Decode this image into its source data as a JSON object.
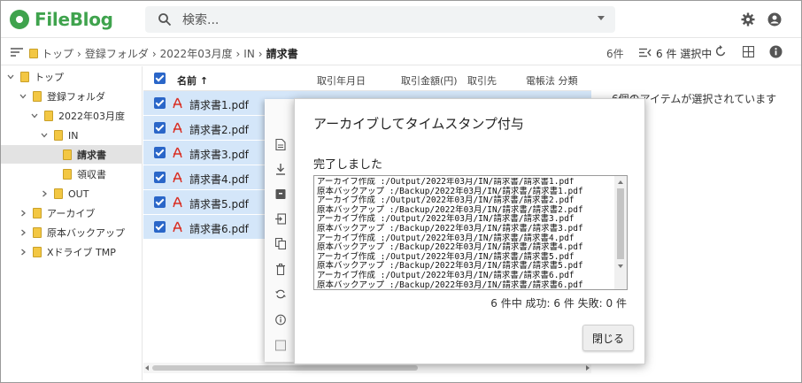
{
  "app": {
    "name": "FileBlog"
  },
  "search": {
    "placeholder": "検索..."
  },
  "breadcrumb": {
    "items": [
      "トップ",
      "登録フォルダ",
      "2022年03月度",
      "IN"
    ],
    "current": "請求書"
  },
  "toolbar": {
    "count": "6件",
    "selection": "6 件 選択中"
  },
  "tree": [
    {
      "label": "トップ",
      "level": 0,
      "expanded": true
    },
    {
      "label": "登録フォルダ",
      "level": 1,
      "expanded": true
    },
    {
      "label": "2022年03月度",
      "level": 2,
      "expanded": true
    },
    {
      "label": "IN",
      "level": 3,
      "expanded": true
    },
    {
      "label": "請求書",
      "level": 4,
      "selected": true
    },
    {
      "label": "領収書",
      "level": 4
    },
    {
      "label": "OUT",
      "level": 3,
      "expanded": false
    },
    {
      "label": "アーカイブ",
      "level": 0,
      "expanded": false
    },
    {
      "label": "原本バックアップ",
      "level": 0,
      "expanded": false
    },
    {
      "label": "Xドライブ TMP",
      "level": 0,
      "expanded": false
    }
  ],
  "list": {
    "headers": {
      "name": "名前 ↑",
      "date": "取引年月日",
      "amount": "取引金額(円)",
      "partner": "取引先",
      "category": "電帳法 分類"
    },
    "rows": [
      "請求書1.pdf",
      "請求書2.pdf",
      "請求書3.pdf",
      "請求書4.pdf",
      "請求書5.pdf",
      "請求書6.pdf"
    ]
  },
  "info_panel": {
    "text": "6個のアイテムが選択されています"
  },
  "dialog": {
    "title": "アーカイブしてタイムスタンプ付与",
    "status": "完了しました",
    "log": [
      "アーカイブ作成 :/Output/2022年03月/IN/請求書/請求書1.pdf",
      "原本バックアップ :/Backup/2022年03月/IN/請求書/請求書1.pdf",
      "アーカイブ作成 :/Output/2022年03月/IN/請求書/請求書2.pdf",
      "原本バックアップ :/Backup/2022年03月/IN/請求書/請求書2.pdf",
      "アーカイブ作成 :/Output/2022年03月/IN/請求書/請求書3.pdf",
      "原本バックアップ :/Backup/2022年03月/IN/請求書/請求書3.pdf",
      "アーカイブ作成 :/Output/2022年03月/IN/請求書/請求書4.pdf",
      "原本バックアップ :/Backup/2022年03月/IN/請求書/請求書4.pdf",
      "アーカイブ作成 :/Output/2022年03月/IN/請求書/請求書5.pdf",
      "原本バックアップ :/Backup/2022年03月/IN/請求書/請求書5.pdf",
      "アーカイブ作成 :/Output/2022年03月/IN/請求書/請求書6.pdf",
      "原本バックアップ :/Backup/2022年03月/IN/請求書/請求書6.pdf"
    ],
    "summary": "6 件中  成功: 6 件  失敗: 0 件",
    "close_label": "閉じる"
  },
  "colors": {
    "brand": "#3fa34d",
    "selection": "#d4e6f9",
    "checkbox": "#2a66c8",
    "pdf": "#d93025",
    "folder": "#f3c743"
  }
}
